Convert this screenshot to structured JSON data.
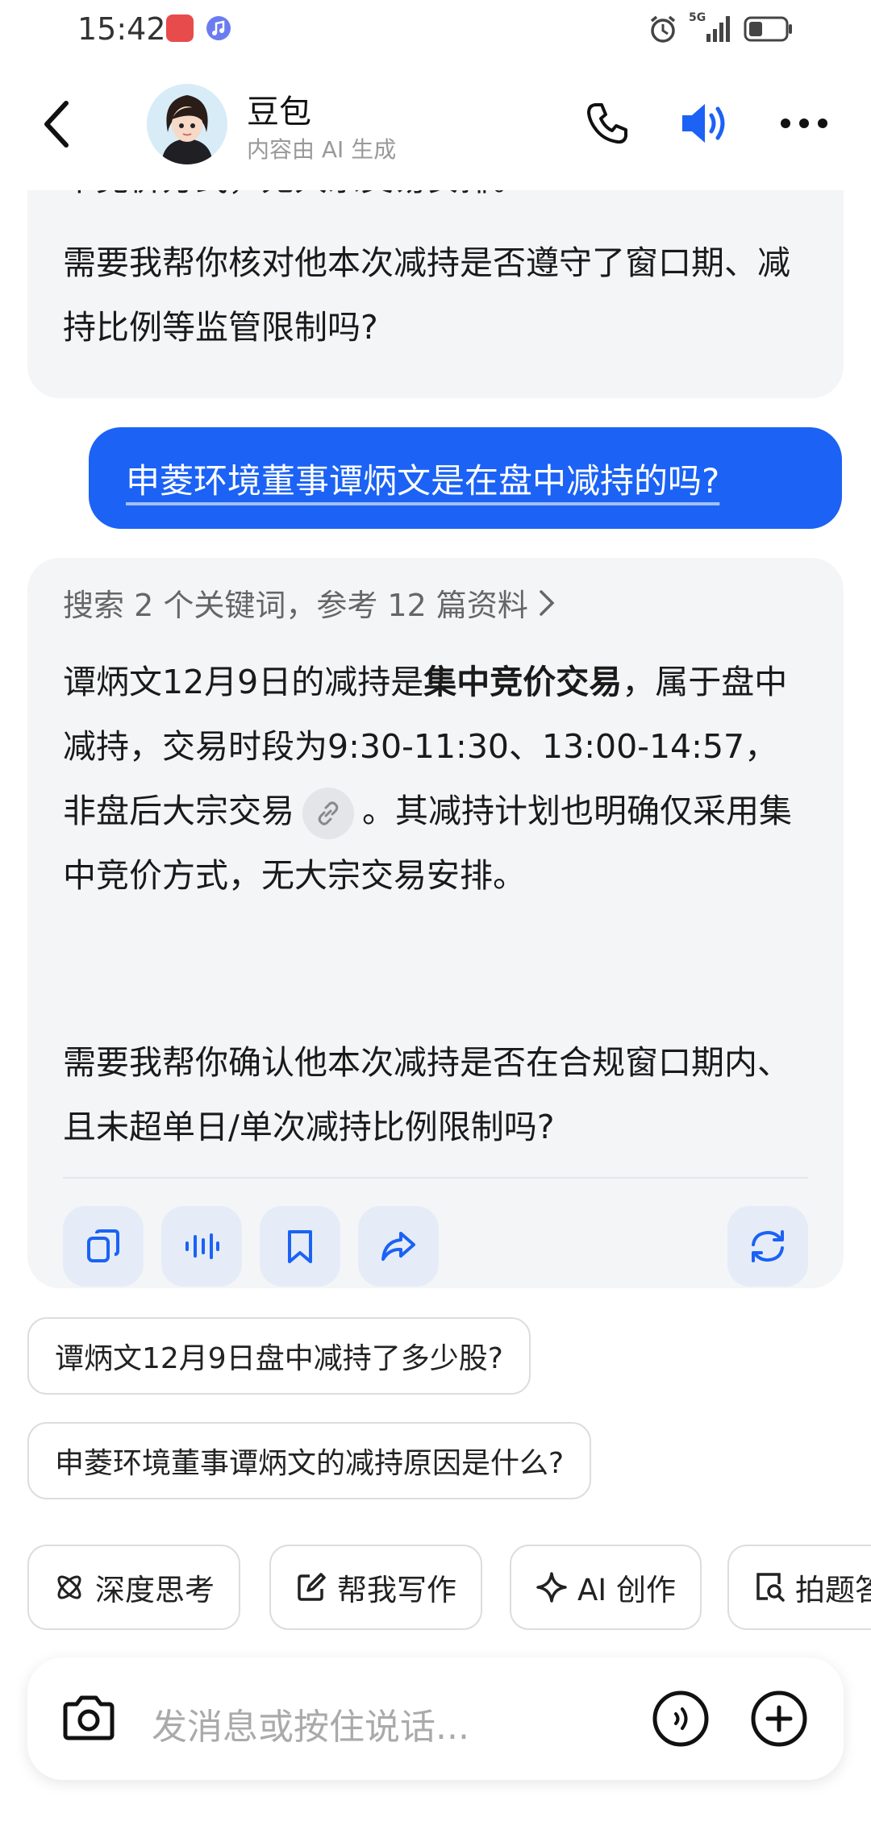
{
  "status_bar": {
    "time": "15:42",
    "network": "5G",
    "icons": [
      "huawei-app-icon",
      "music-icon",
      "alarm-icon",
      "signal-icon",
      "battery-icon"
    ]
  },
  "header": {
    "bot_name": "豆包",
    "subtitle": "内容由 AI 生成",
    "icons": [
      "back-icon",
      "phone-icon",
      "speaker-icon",
      "more-icon"
    ]
  },
  "messages": {
    "partial_text_clipped": "中竞价方式，无大宗交易安排。",
    "previous_bot_followup": "需要我帮你核对他本次减持是否遵守了窗口期、减持比例等监管限制吗?",
    "user_question": "申菱环境董事谭炳文是在盘中减持的吗?",
    "search_summary": "搜索 2 个关键词，参考 12 篇资料",
    "answer_part1": "谭炳文12月9日的减持是",
    "answer_bold": "集中竞价交易",
    "answer_part2": "，属于盘中减持，交易时段为9:30-11:30、13:00-14:57，非盘后大宗交易",
    "answer_part3": "。其减持计划也明确仅采用集中竞价方式，无大宗交易安排。",
    "answer_followup": "需要我帮你确认他本次减持是否在合规窗口期内、且未超单日/单次减持比例限制吗?"
  },
  "actions": [
    "copy-icon",
    "voice-play-icon",
    "bookmark-icon",
    "share-icon",
    "regenerate-icon"
  ],
  "suggestions": [
    "谭炳文12月9日盘中减持了多少股?",
    "申菱环境董事谭炳文的减持原因是什么?"
  ],
  "tools": [
    {
      "label": "深度思考",
      "icon": "atom-icon"
    },
    {
      "label": "帮我写作",
      "icon": "edit-icon"
    },
    {
      "label": "AI 创作",
      "icon": "sparkle-icon"
    },
    {
      "label": "拍题答",
      "icon": "photo-search-icon"
    }
  ],
  "composer": {
    "placeholder": "发消息或按住说话..."
  },
  "colors": {
    "accent": "#1b62f5",
    "bubble_bg": "#f4f5f7",
    "action_bg": "#e5ecf7",
    "icon_blue": "#1b62f5"
  }
}
